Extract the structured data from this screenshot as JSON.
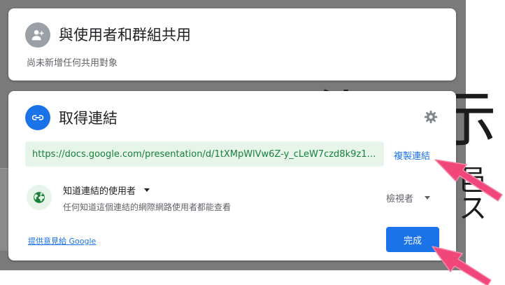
{
  "share_card": {
    "title": "與使用者和群組共用",
    "subtitle": "尚未新增任何共用對象",
    "icon": "person-add-icon"
  },
  "link_card": {
    "title": "取得連結",
    "icon": "link-icon",
    "settings_icon": "gear-icon",
    "url": "https://docs.google.com/presentation/d/1tXMpWlVw6Z-y_cLeW7czd8k9z18…",
    "copy_label": "複製連結",
    "access": {
      "icon": "globe-icon",
      "title": "知道連結的使用者",
      "description": "任何知道這個連結的網際網路使用者都能查看",
      "role": "檢視者"
    },
    "feedback_label": "提供意見給 Google",
    "done_label": "完成"
  },
  "colors": {
    "accent": "#1a73e8",
    "link_green": "#188038",
    "url_bg": "#e6f4ea",
    "arrow_pink": "#f0467a"
  }
}
